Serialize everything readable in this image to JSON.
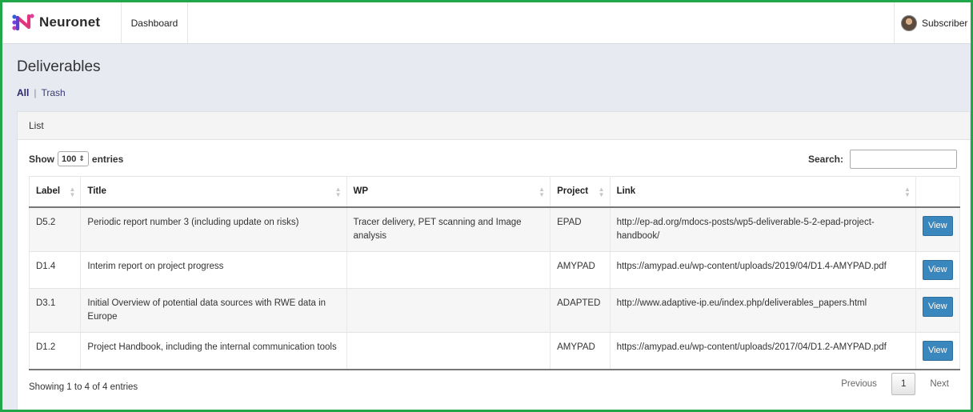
{
  "app": {
    "brand": "Neuronet",
    "nav_dashboard": "Dashboard",
    "user_name": "Subscriber",
    "accent_color": "#3a87bd",
    "frame_color": "#22a64a"
  },
  "page": {
    "title": "Deliverables",
    "filter_all": "All",
    "filter_sep": "|",
    "filter_trash": "Trash"
  },
  "panel": {
    "heading": "List",
    "show_label": "Show",
    "page_length": "100",
    "entries_label": "entries",
    "search_label": "Search:",
    "search_value": ""
  },
  "table": {
    "columns": [
      "Label",
      "Title",
      "WP",
      "Project",
      "Link",
      ""
    ],
    "rows": [
      {
        "label": "D5.2",
        "title": "Periodic report number 3 (including update on risks)",
        "wp": "Tracer delivery, PET scanning and Image analysis",
        "project": "EPAD",
        "link": "http://ep-ad.org/mdocs-posts/wp5-deliverable-5-2-epad-project-handbook/",
        "action": "View"
      },
      {
        "label": "D1.4",
        "title": "Interim report on project progress",
        "wp": "",
        "project": "AMYPAD",
        "link": "https://amypad.eu/wp-content/uploads/2019/04/D1.4-AMYPAD.pdf",
        "action": "View"
      },
      {
        "label": "D3.1",
        "title": "Initial Overview of potential data sources with RWE data in Europe",
        "wp": "",
        "project": "ADAPTED",
        "link": "http://www.adaptive-ip.eu/index.php/deliverables_papers.html",
        "action": "View"
      },
      {
        "label": "D1.2",
        "title": "Project Handbook, including the internal communication tools",
        "wp": "",
        "project": "AMYPAD",
        "link": "https://amypad.eu/wp-content/uploads/2017/04/D1.2-AMYPAD.pdf",
        "action": "View"
      }
    ]
  },
  "footer": {
    "info": "Showing 1 to 4 of 4 entries",
    "previous": "Previous",
    "current_page": "1",
    "next": "Next"
  }
}
